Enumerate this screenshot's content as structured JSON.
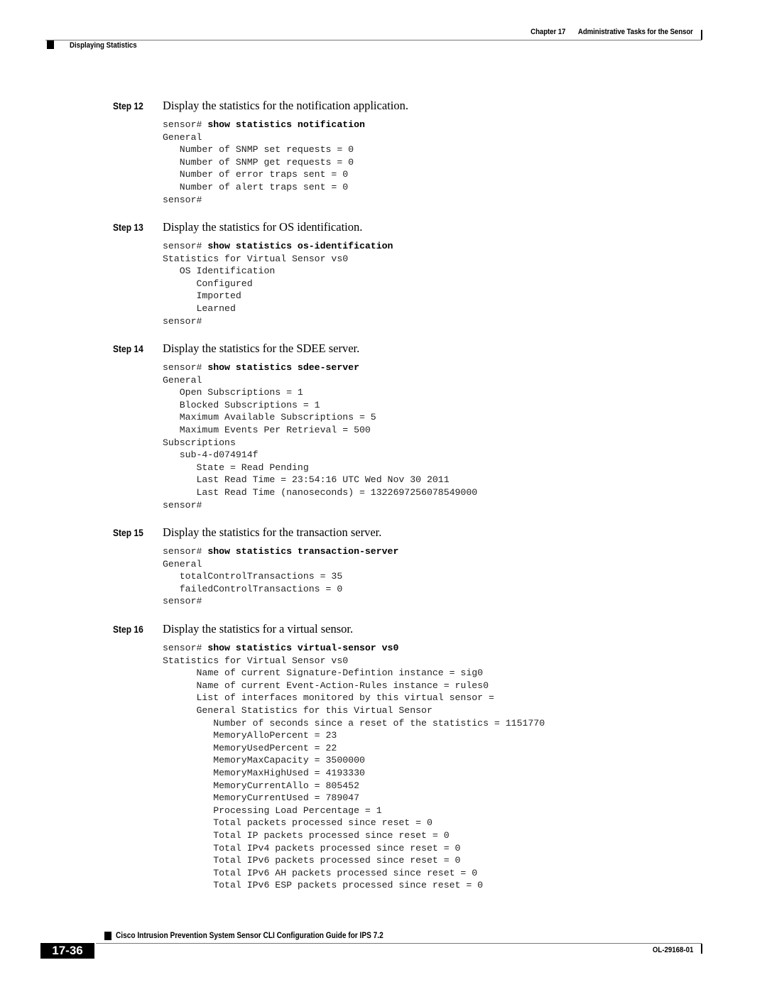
{
  "header": {
    "chapter_label": "Chapter 17",
    "chapter_title": "Administrative Tasks for the Sensor",
    "section": "Displaying Statistics"
  },
  "steps": [
    {
      "label": "Step 12",
      "title": "Display the statistics for the notification application.",
      "prompt": "sensor# ",
      "command": "show statistics notification",
      "output": [
        "General",
        "   Number of SNMP set requests = 0",
        "   Number of SNMP get requests = 0",
        "   Number of error traps sent = 0",
        "   Number of alert traps sent = 0",
        "sensor#"
      ]
    },
    {
      "label": "Step 13",
      "title": "Display the statistics for OS identification.",
      "prompt": "sensor# ",
      "command": "show statistics os-identification",
      "output": [
        "Statistics for Virtual Sensor vs0",
        "   OS Identification",
        "      Configured",
        "      Imported",
        "      Learned",
        "sensor#"
      ]
    },
    {
      "label": "Step 14",
      "title": "Display the statistics for the SDEE server.",
      "prompt": "sensor# ",
      "command": "show statistics sdee-server",
      "output": [
        "General",
        "   Open Subscriptions = 1",
        "   Blocked Subscriptions = 1",
        "   Maximum Available Subscriptions = 5",
        "   Maximum Events Per Retrieval = 500",
        "Subscriptions",
        "   sub-4-d074914f",
        "      State = Read Pending",
        "      Last Read Time = 23:54:16 UTC Wed Nov 30 2011",
        "      Last Read Time (nanoseconds) = 1322697256078549000",
        "sensor#"
      ]
    },
    {
      "label": "Step 15",
      "title": "Display the statistics for the transaction server.",
      "prompt": "sensor# ",
      "command": "show statistics transaction-server",
      "output": [
        "General",
        "   totalControlTransactions = 35",
        "   failedControlTransactions = 0",
        "sensor#"
      ]
    },
    {
      "label": "Step 16",
      "title": "Display the statistics for a virtual sensor.",
      "prompt": "sensor# ",
      "command": "show statistics virtual-sensor vs0",
      "output": [
        "Statistics for Virtual Sensor vs0",
        "      Name of current Signature-Defintion instance = sig0",
        "      Name of current Event-Action-Rules instance = rules0",
        "      List of interfaces monitored by this virtual sensor =",
        "      General Statistics for this Virtual Sensor",
        "         Number of seconds since a reset of the statistics = 1151770",
        "         MemoryAlloPercent = 23",
        "         MemoryUsedPercent = 22",
        "         MemoryMaxCapacity = 3500000",
        "         MemoryMaxHighUsed = 4193330",
        "         MemoryCurrentAllo = 805452",
        "         MemoryCurrentUsed = 789047",
        "         Processing Load Percentage = 1",
        "         Total packets processed since reset = 0",
        "         Total IP packets processed since reset = 0",
        "         Total IPv4 packets processed since reset = 0",
        "         Total IPv6 packets processed since reset = 0",
        "         Total IPv6 AH packets processed since reset = 0",
        "         Total IPv6 ESP packets processed since reset = 0"
      ]
    }
  ],
  "footer": {
    "guide_title": "Cisco Intrusion Prevention System Sensor CLI Configuration Guide for IPS 7.2",
    "page_number": "17-36",
    "doc_number": "OL-29168-01"
  }
}
